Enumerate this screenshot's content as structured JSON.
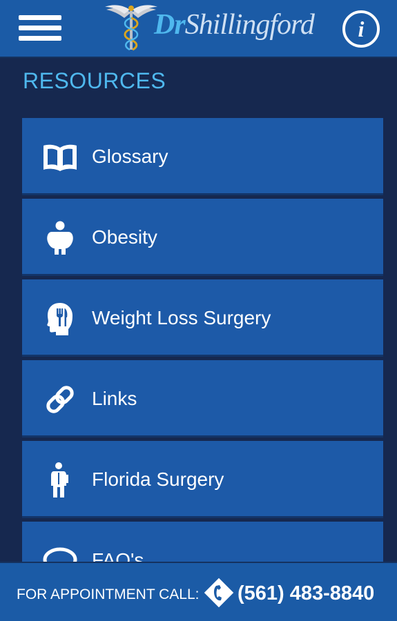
{
  "header": {
    "logo_prefix": "Dr",
    "logo_name": "Shillingford",
    "menu_icon": "hamburger-menu-icon",
    "info_icon": "info-icon",
    "info_glyph": "i"
  },
  "section": {
    "title": "RESOURCES"
  },
  "resources": {
    "items": [
      {
        "label": "Glossary",
        "icon": "book-icon"
      },
      {
        "label": "Obesity",
        "icon": "person-obese-icon"
      },
      {
        "label": "Weight Loss Surgery",
        "icon": "head-fork-knife-icon"
      },
      {
        "label": "Links",
        "icon": "link-icon"
      },
      {
        "label": "Florida Surgery",
        "icon": "surgeon-icon"
      },
      {
        "label": "FAQ's",
        "icon": "chat-bubble-icon"
      }
    ]
  },
  "footer": {
    "label": "FOR APPOINTMENT CALL:",
    "phone": "(561) 483-8840",
    "phone_icon": "phone-diamond-icon"
  },
  "colors": {
    "background": "#16284f",
    "bar": "#1b5ba6",
    "item": "#1d5aa8",
    "accent": "#4fb8ee",
    "text": "#ffffff"
  }
}
